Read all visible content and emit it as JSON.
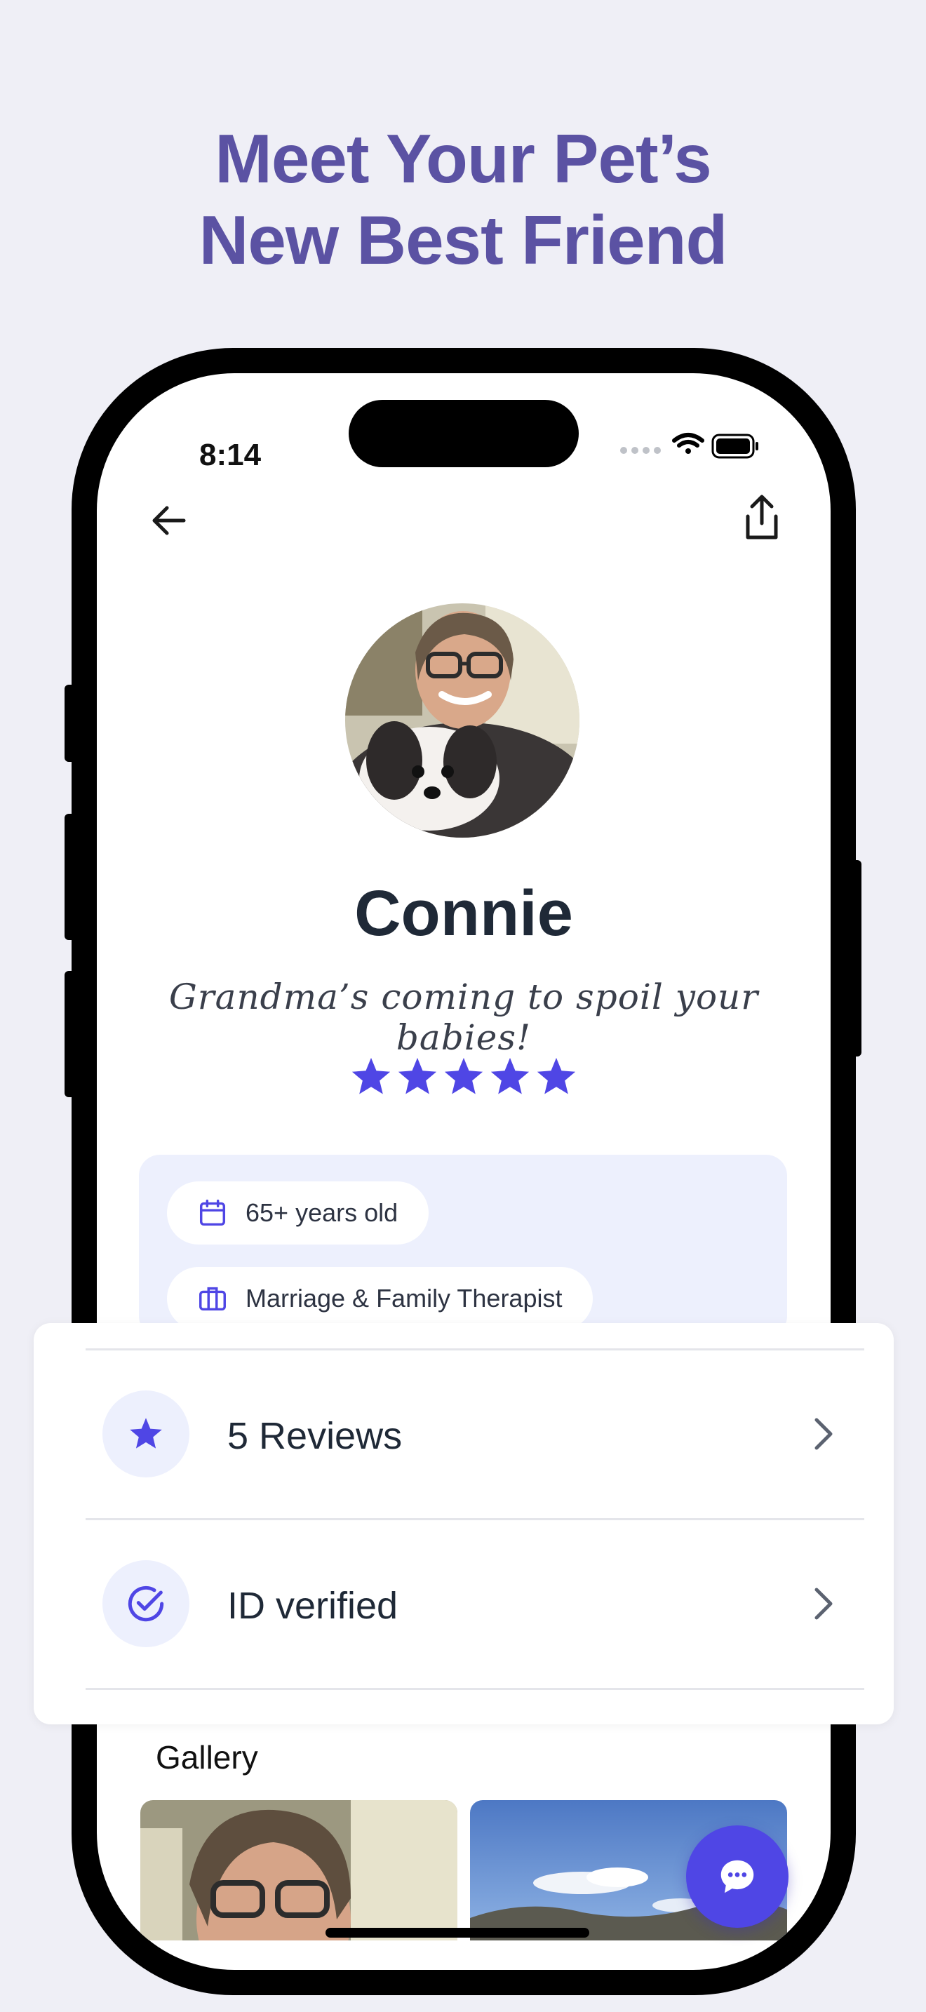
{
  "headline": {
    "line1": "Meet Your Pet’s",
    "line2": "New Best Friend"
  },
  "status_bar": {
    "time": "8:14"
  },
  "profile": {
    "name": "Connie",
    "tagline": "Grandma’s coming to spoil your babies!",
    "rating_stars": 5,
    "details": [
      {
        "icon": "calendar-icon",
        "label": "65+ years old"
      },
      {
        "icon": "briefcase-icon",
        "label": "Marriage & Family Therapist"
      }
    ]
  },
  "rows": [
    {
      "icon": "star-icon",
      "label": "5 Reviews"
    },
    {
      "icon": "check-circle-icon",
      "label": "ID verified"
    }
  ],
  "gallery": {
    "title": "Gallery"
  },
  "colors": {
    "background": "#efeff6",
    "headline": "#5b52a3",
    "accent": "#4f46e5",
    "chip_bg": "#edf0fd",
    "text_dark": "#1f2937"
  }
}
